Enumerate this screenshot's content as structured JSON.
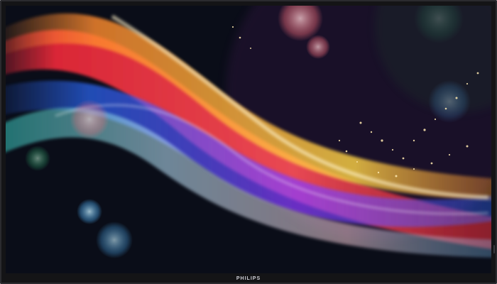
{
  "device": {
    "brand_label": "PHILIPS"
  },
  "display": {
    "wallpaper": "abstract-color-waves",
    "colors": {
      "bezel": "#141416",
      "screen_bg": "#0a0d18",
      "wave_red": "#ff3b4f",
      "wave_orange": "#ff9a2f",
      "wave_yellow": "#ffd447",
      "wave_blue": "#2c6bff",
      "wave_purple": "#8a3bff",
      "wave_teal": "#1fa79b",
      "bokeh_pink": "#ff6f7c",
      "bokeh_blue": "#4fb5ff",
      "bokeh_green": "#3be08a"
    }
  }
}
